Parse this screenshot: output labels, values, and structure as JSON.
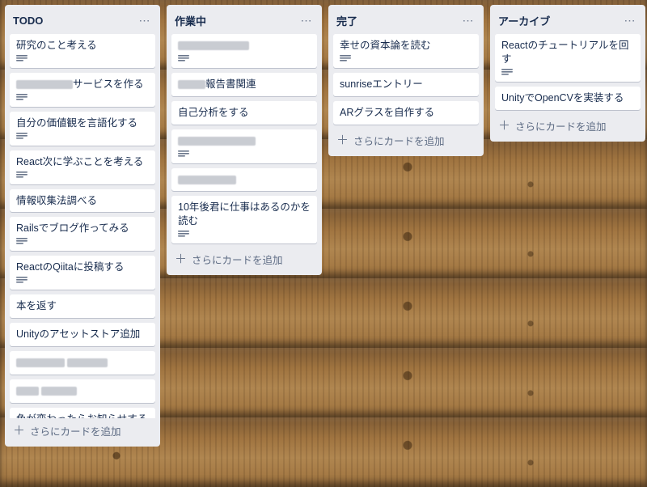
{
  "add_card_label": "さらにカードを追加",
  "lists": [
    {
      "title": "TODO",
      "cards": [
        {
          "title": "研究のこと考える",
          "desc": true
        },
        {
          "title_parts": [
            {
              "blur_w": 70
            },
            {
              "text": "サービスを作る"
            }
          ],
          "desc": true
        },
        {
          "title": "自分の価値観を言語化する",
          "desc": true
        },
        {
          "title": "React次に学ぶことを考える",
          "desc": true
        },
        {
          "title": "情報収集法調べる"
        },
        {
          "title": "Railsでブログ作ってみる",
          "desc": true
        },
        {
          "title": "ReactのQiitaに投稿する",
          "desc": true
        },
        {
          "title": "本を返す"
        },
        {
          "title": "Unityのアセットストア追加"
        },
        {
          "title_parts": [
            {
              "blur_w": 60
            },
            {
              "text": " "
            },
            {
              "blur_w": 50
            }
          ]
        },
        {
          "title_parts": [
            {
              "blur_w": 28
            },
            {
              "text": " "
            },
            {
              "blur_w": 44
            }
          ]
        },
        {
          "title": "色が変わったらお知らせするbot作る"
        }
      ]
    },
    {
      "title": "作業中",
      "cards": [
        {
          "title_parts": [
            {
              "blur_w": 88
            }
          ],
          "desc": true
        },
        {
          "title_parts": [
            {
              "blur_w": 34
            },
            {
              "text": "報告書関連"
            }
          ]
        },
        {
          "title": "自己分析をする"
        },
        {
          "title_parts": [
            {
              "blur_w": 96
            }
          ],
          "desc": true
        },
        {
          "title_parts": [
            {
              "blur_w": 72
            }
          ]
        },
        {
          "title": "10年後君に仕事はあるのかを読む",
          "desc": true
        }
      ]
    },
    {
      "title": "完了",
      "cards": [
        {
          "title": "幸せの資本論を読む",
          "desc": true
        },
        {
          "title": "sunriseエントリー"
        },
        {
          "title": "ARグラスを自作する"
        }
      ]
    },
    {
      "title": "アーカイブ",
      "cards": [
        {
          "title": "Reactのチュートリアルを回す",
          "desc": true
        },
        {
          "title": "UnityでOpenCVを実装する"
        }
      ]
    }
  ]
}
